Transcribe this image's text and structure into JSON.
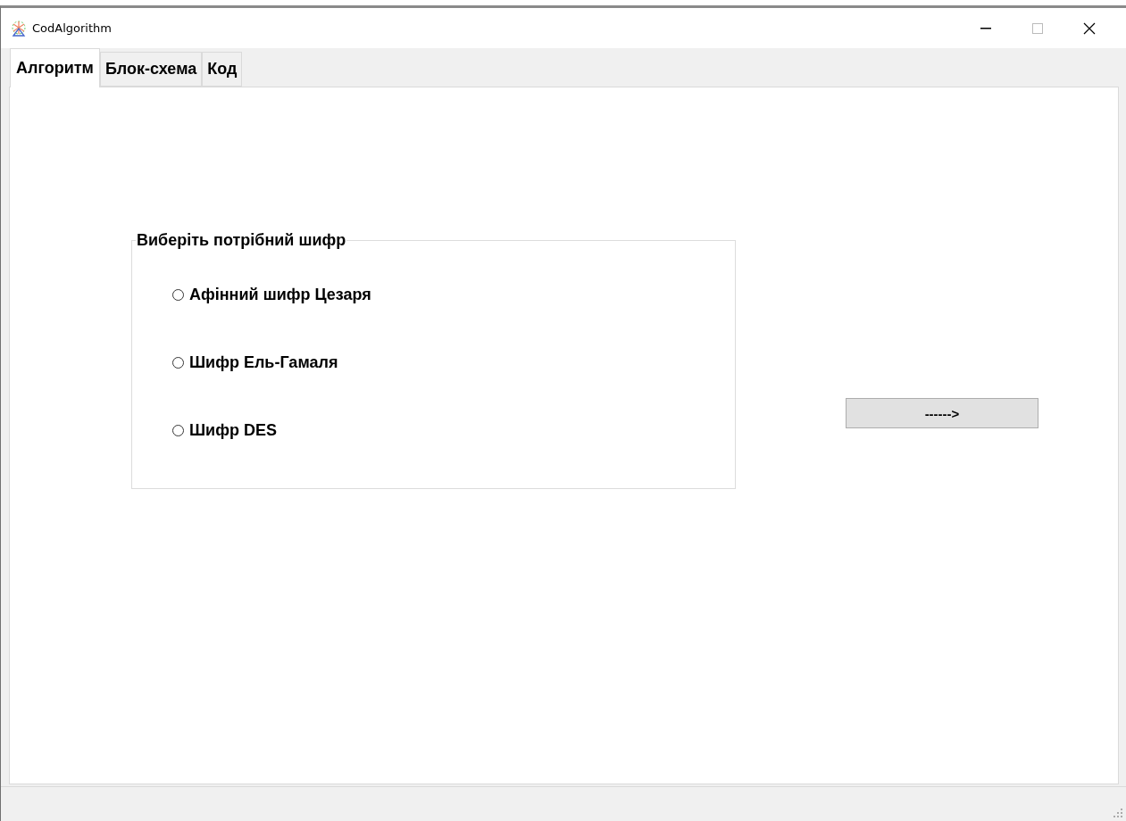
{
  "window": {
    "title": "CodAlgorithm"
  },
  "tabs": [
    {
      "label": "Алгоритм",
      "selected": true
    },
    {
      "label": "Блок-схема",
      "selected": false
    },
    {
      "label": "Код",
      "selected": false
    }
  ],
  "group": {
    "title": "Виберіть потрібний шифр",
    "options": [
      {
        "label": "Афінний шифр Цезаря",
        "selected": false
      },
      {
        "label": "Шифр Ель-Гамаля",
        "selected": false
      },
      {
        "label": "Шифр DES",
        "selected": false
      }
    ]
  },
  "next_button": {
    "label": "------>"
  }
}
